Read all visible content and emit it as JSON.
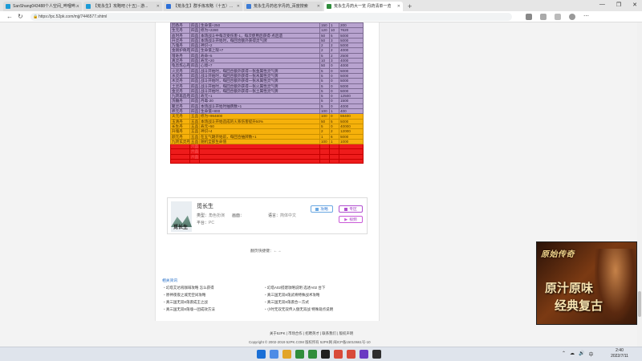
{
  "browser": {
    "tabs": [
      {
        "title": "SanShang043488个人空间_哔哩哔...",
        "color": "#1c9bd6"
      },
      {
        "title": "【荒永生】攻略吧 (十五) - 游...",
        "color": "#1c9bd6"
      },
      {
        "title": "【荒永生】群手炼攻略（十五）...",
        "color": "#2c6fd8"
      },
      {
        "title": "荒永生丹药名字丹药_百度搜索",
        "color": "#3b7bd6"
      },
      {
        "title": "荒永生丹药大一览 丹药清单一览",
        "color": "#2f8d3c",
        "active": true
      }
    ],
    "new_tab": "+",
    "window_controls": [
      "—",
      "❐",
      "✕"
    ],
    "url": "https://pc.52pk.com/mjj/7446577.shtml",
    "nav": {
      "back": "←",
      "refresh": "↻"
    },
    "more": "⋯"
  },
  "table": {
    "rows": [
      {
        "style": "purple",
        "cells": [
          "回香丹",
          "四品",
          "生命值+250",
          "150",
          "1",
          "200"
        ]
      },
      {
        "style": "purple",
        "cells": [
          "生元丹",
          "四品",
          "修为+2280",
          "120",
          "10",
          "7620"
        ]
      },
      {
        "style": "purple",
        "cells": [
          "血时丹",
          "四品",
          "本场战斗中每次受伤害-1，每次使用后获得-点后遗",
          "50",
          "5",
          "5000"
        ]
      },
      {
        "style": "purple",
        "cells": [
          "升灵丹",
          "四品",
          "本场战斗开始时，每回合额外获得灵气牌",
          "50",
          "3",
          "5000"
        ]
      },
      {
        "style": "purple",
        "cells": [
          "乃魂丹",
          "四品",
          "神识+2",
          "2",
          "2",
          "5000"
        ]
      },
      {
        "style": "purple",
        "cells": [
          "金刚护骨丹",
          "四品",
          "生命值上限+7",
          "2",
          "2",
          "4000"
        ]
      },
      {
        "style": "purple",
        "cells": [
          "增寿丹",
          "四品",
          "寿命+5",
          "5",
          "2",
          "2500"
        ]
      },
      {
        "style": "purple",
        "cells": [
          "真灵丹",
          "四品",
          "寿元+20",
          "10",
          "3",
          "4000"
        ]
      },
      {
        "style": "purple",
        "cells": [
          "龟息炼心丹",
          "四品",
          "心境+7",
          "50",
          "0",
          "4000"
        ]
      },
      {
        "style": "purple",
        "cells": [
          "火灵丹",
          "四品",
          "战斗开始时，每回合额外获得一张金属性灵气牌",
          "5",
          "0",
          "5000"
        ]
      },
      {
        "style": "purple",
        "cells": [
          "水灵丹",
          "四品",
          "战斗开始时，每回合额外获得一张木属性灵气牌",
          "5",
          "0",
          "5000"
        ]
      },
      {
        "style": "purple",
        "cells": [
          "木灵丹",
          "四品",
          "战斗开始时，每回合额外获得一张水属性灵气牌",
          "5",
          "0",
          "5000"
        ]
      },
      {
        "style": "purple",
        "cells": [
          "土灵丹",
          "四品",
          "战斗开始时，每回合额外获得一张火属性灵气牌",
          "5",
          "0",
          "5000"
        ]
      },
      {
        "style": "purple",
        "cells": [
          "金灵丹",
          "四品",
          "战斗开始时，每回合额外获得一张土属性灵气牌",
          "5",
          "0",
          "5000"
        ]
      },
      {
        "style": "purple",
        "cells": [
          "九转再造丹",
          "四品",
          "寿元+1",
          "5",
          "0",
          "12500"
        ]
      },
      {
        "style": "purple",
        "cells": [
          "洗髓丹",
          "四品",
          "丹毒-20",
          "5",
          "0",
          "1500"
        ]
      },
      {
        "style": "purple",
        "cells": [
          "聚灵丹",
          "四品",
          "本场战斗开始时抽牌数+1",
          "5",
          "0",
          "4000"
        ]
      },
      {
        "style": "purple",
        "cells": [
          "养元丹",
          "四品",
          "生命值+800",
          "100",
          "1",
          "400"
        ]
      },
      {
        "style": "gold",
        "cells": [
          "天元丹",
          "五品",
          "修为+994800",
          "100",
          "0",
          "59400"
        ]
      },
      {
        "style": "gold",
        "cells": [
          "玉清丹",
          "五品",
          "本场战斗开始造成的火系伤害提升50%",
          "50",
          "5",
          "5000"
        ]
      },
      {
        "style": "gold",
        "cells": [
          "长生丹",
          "五品",
          "寿元+50",
          "5",
          "0",
          "40000"
        ]
      },
      {
        "style": "gold",
        "cells": [
          "升魂丹",
          "五品",
          "神识+4",
          "2",
          "2",
          "12000"
        ]
      },
      {
        "style": "gold",
        "cells": [
          "颜元丹",
          "五品",
          "在五气期开始前，每回合抽牌数+1",
          "1",
          "6",
          "5000"
        ]
      },
      {
        "style": "gold",
        "cells": [
          "九转玄灵丹",
          "五品",
          "随机全部生命值",
          "100",
          "1",
          "1000"
        ]
      },
      {
        "style": "red",
        "cells": [
          "",
          "六品",
          "",
          "",
          "",
          ""
        ]
      },
      {
        "style": "red",
        "cells": [
          "",
          "六品",
          "",
          "",
          "",
          ""
        ]
      },
      {
        "style": "red",
        "cells": [
          "",
          "六品",
          "",
          "",
          "",
          ""
        ]
      },
      {
        "style": "red",
        "cells": [
          "",
          "",
          "",
          "",
          "",
          ""
        ]
      }
    ]
  },
  "game_card": {
    "name": "觅长生",
    "cover_text": "觅长生",
    "type_label": "类型：",
    "type_value": "角色扮演",
    "screen_label": "画面：",
    "screen_value": "",
    "language_label": "语言：",
    "language_value": "简体中文",
    "platform_label": "平台：",
    "platform_value": "PC",
    "strategy_btn": "攻略",
    "pack_btn": "专区",
    "video_btn": "视频"
  },
  "page_jump": "翻页快捷键：←→",
  "related": {
    "title": "相关资讯",
    "left": [
      "幻塔艾达吼咖啡攻略 怎么获得",
      "原神夜夜之城无空间攻略",
      "真三国无双8荡袭成王之战",
      "真三国无双8荡魂一团成效方法"
    ],
    "right": [
      "幻塔A02搭建攻略说明 选述A02 台下",
      "真三国无双8荡武将特殊战术攻略",
      "真三国无双8荡袭合一方式",
      "小时无双无双传入傲无双战 特殊观点说明"
    ]
  },
  "footer": {
    "links": "关于52PK | 市场合作 | 招聘英才 | 联系我们 | 版权声明",
    "copyright": "Copyright © 2002-2019 52PK.COM 版权所有 52PK网 闽ICP备15010661号-10"
  },
  "floating_video": {
    "logo": "原始传奇",
    "line1": "原汁原味",
    "line2": "经典复古"
  },
  "taskbar": {
    "time": "2:40",
    "date": "2022/7/11",
    "lang": "中",
    "tray": [
      "⌃",
      "☁",
      "🔊"
    ],
    "app_colors": [
      "#1a6fd6",
      "#4d8ce6",
      "#e2a427",
      "#2f8d3c",
      "#2f8d3c",
      "#1f1f1f",
      "#d84a3a",
      "#d84a3a",
      "#6a3ac2",
      "#2e2e2e"
    ]
  }
}
